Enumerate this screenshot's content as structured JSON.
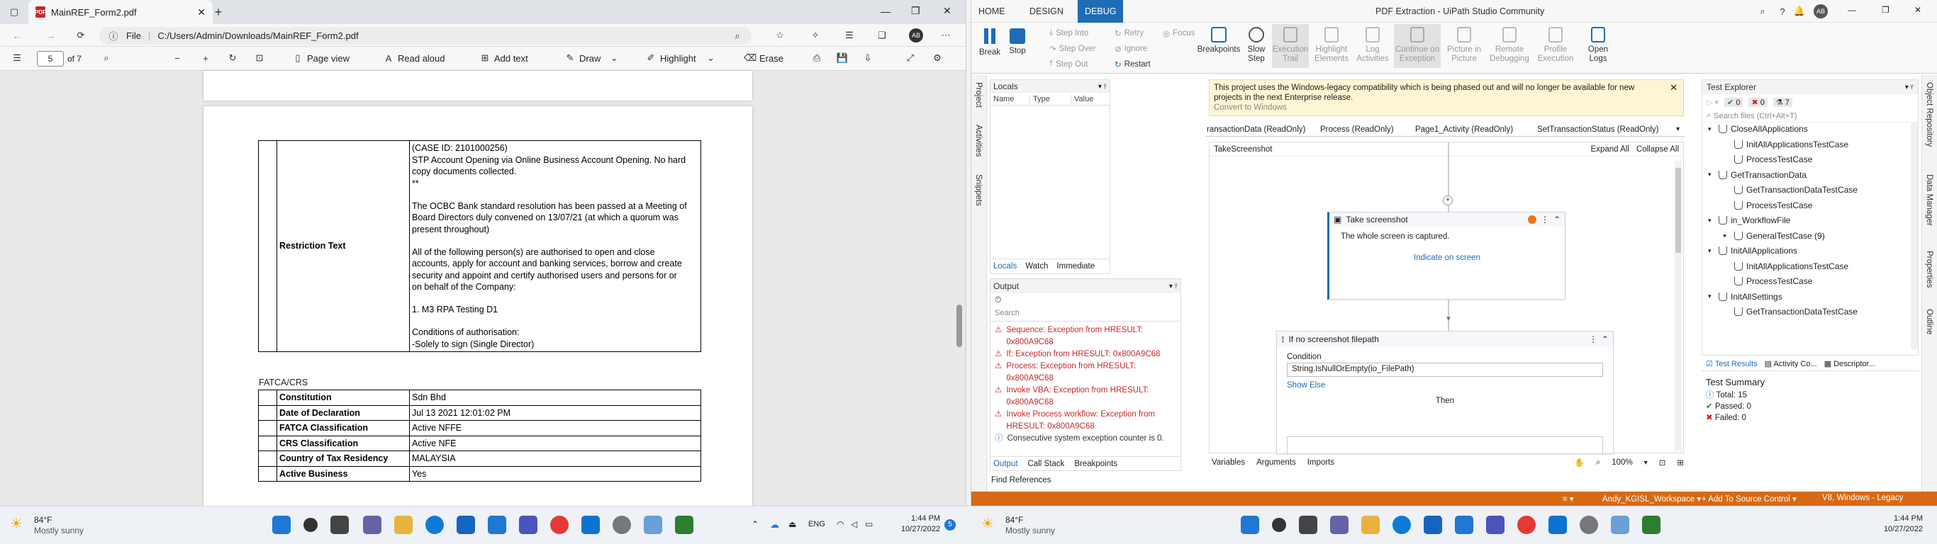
{
  "edge": {
    "tab_title": "MainREF_Form2.pdf",
    "address_label": "File",
    "address_url": "C:/Users/Admin/Downloads/MainREF_Form2.pdf",
    "profile": "AB",
    "page_current": "5",
    "page_total": "of 7",
    "toolbar": {
      "page_view": "Page view",
      "read_aloud": "Read aloud",
      "add_text": "Add text",
      "draw": "Draw",
      "highlight": "Highlight",
      "erase": "Erase"
    }
  },
  "document": {
    "restriction_label": "Restriction Text",
    "restriction_lines": [
      "(CASE ID: 2101000256)",
      "STP Account Opening via Online Business Account Opening. No hard",
      "copy documents collected.",
      "**",
      "",
      "The OCBC Bank standard resolution has been passed at a Meeting of",
      "Board Directors duly convened on 13/07/21 (at which a quorum was",
      "present throughout)",
      "",
      "All of the following person(s) are authorised to open and close",
      "accounts, apply for account and banking services, borrow and create",
      "security and appoint and certify authorised users and persons for or",
      "on behalf of the Company:",
      "",
      "1. M3 RPA Testing D1",
      "",
      "Conditions of authorisation:",
      "-Solely to sign (Single Director)"
    ],
    "section_heading": "FATCA/CRS",
    "fatca_rows": [
      {
        "label": "Constitution",
        "value": "Sdn Bhd"
      },
      {
        "label": "Date of Declaration",
        "value": "Jul 13 2021 12:01:02 PM"
      },
      {
        "label": "FATCA Classification",
        "value": "Active NFFE"
      },
      {
        "label": "CRS Classification",
        "value": "Active NFE"
      },
      {
        "label": "Country of Tax Residency",
        "value": "MALAYSIA"
      },
      {
        "label": "Active Business",
        "value": "Yes"
      }
    ]
  },
  "taskbar_left": {
    "temp": "84°F",
    "weather": "Mostly sunny",
    "lang": "ENG",
    "time": "1:44 PM",
    "date": "10/27/2022",
    "notif": "5"
  },
  "taskbar_right": {
    "temp": "84°F",
    "weather": "Mostly sunny",
    "time": "1:44 PM",
    "date": "10/27/2022"
  },
  "uipath": {
    "tabs": [
      "HOME",
      "DESIGN",
      "DEBUG"
    ],
    "active_tab": "DEBUG",
    "window_title": "PDF Extraction - UiPath Studio Community",
    "profile": "AB",
    "ribbon": {
      "break": "Break",
      "stop": "Stop",
      "step_into": "Step Into",
      "step_over": "Step Over",
      "step_out": "Step Out",
      "retry": "Retry",
      "ignore": "Ignore",
      "restart": "Restart",
      "focus": "Focus",
      "breakpoints": "Breakpoints",
      "slow_step": "Slow Step",
      "execution_trail": "Execution Trail",
      "highlight_elements": "Highlight Elements",
      "log_activities": "Log Activities",
      "continue_on_exception": "Continue on Exception",
      "picture_in_picture": "Picture in Picture",
      "remote_debugging": "Remote Debugging",
      "profile_execution": "Profile Execution",
      "open_logs": "Open Logs"
    },
    "side_tabs": [
      "Project",
      "Activities",
      "Snippets"
    ],
    "locals": {
      "title": "Locals",
      "columns": [
        "Name",
        "Type",
        "Value"
      ],
      "bottom_tabs": [
        "Locals",
        "Watch",
        "Immediate"
      ]
    },
    "output": {
      "title": "Output",
      "search_placeholder": "Search",
      "lines": [
        {
          "text": "Sequence: Exception from HRESULT: 0x800A9C68",
          "kind": "error"
        },
        {
          "text": "If: Exception from HRESULT: 0x800A9C68",
          "kind": "error"
        },
        {
          "text": "Process: Exception from HRESULT: 0x800A9C68",
          "kind": "error"
        },
        {
          "text": "Invoke VBA: Exception from HRESULT: 0x800A9C68",
          "kind": "error"
        },
        {
          "text": "Invoke Process workflow: Exception from HRESULT: 0x800A9C68",
          "kind": "error"
        },
        {
          "text": "Consecutive system exception counter is 0.",
          "kind": "info"
        }
      ],
      "bottom_tabs": [
        "Output",
        "Call Stack",
        "Breakpoints"
      ]
    },
    "banner": {
      "text": "This project uses the Windows-legacy compatibility which is being phased out and will no longer be available for new projects in the next Enterprise release.",
      "link": "Convert to Windows"
    },
    "doc_tabs": [
      "ransactionData (ReadOnly)",
      "Process (ReadOnly)",
      "Page1_Activity (ReadOnly)",
      "SetTransactionStatus (ReadOnly)"
    ],
    "breadcrumb": "TakeScreenshot",
    "expand_all": "Expand All",
    "collapse_all": "Collapse All",
    "activity1": {
      "title": "Take screenshot",
      "desc": "The whole screen is captured.",
      "link": "Indicate on screen"
    },
    "activity2": {
      "title": "If no screenshot filepath",
      "condition_label": "Condition",
      "condition": "String.IsNullOrEmpty(io_FilePath)",
      "show_else": "Show Else",
      "then": "Then"
    },
    "designer_bottom": [
      "Variables",
      "Arguments",
      "Imports"
    ],
    "zoom": "100%",
    "find_references": "Find References",
    "test_explorer": {
      "title": "Test Explorer",
      "counts": [
        "0",
        "0",
        "7"
      ],
      "search_placeholder": "Search files (Ctrl+Alt+T)",
      "tree": [
        {
          "label": "CloseAllApplications",
          "level": 0
        },
        {
          "label": "InitAllApplicationsTestCase",
          "level": 1
        },
        {
          "label": "ProcessTestCase",
          "level": 1
        },
        {
          "label": "GetTransactionData",
          "level": 0
        },
        {
          "label": "GetTransactionDataTestCase",
          "level": 1
        },
        {
          "label": "ProcessTestCase",
          "level": 1
        },
        {
          "label": "in_WorkflowFile",
          "level": 0
        },
        {
          "label": "GeneralTestCase (9)",
          "level": 1
        },
        {
          "label": "InitAllApplications",
          "level": 0
        },
        {
          "label": "InitAllApplicationsTestCase",
          "level": 1
        },
        {
          "label": "ProcessTestCase",
          "level": 1
        },
        {
          "label": "InitAllSettings",
          "level": 0
        },
        {
          "label": "GetTransactionDataTestCase",
          "level": 1
        }
      ],
      "bottom_tabs": [
        "Test Results",
        "Activity Co...",
        "Descriptor..."
      ],
      "summary_title": "Test Summary",
      "total": "Total: 15",
      "passed": "Passed: 0",
      "failed": "Failed: 0"
    },
    "right_side_tabs": [
      "Object Repository",
      "Data Manager",
      "Properties",
      "Outline"
    ],
    "status": {
      "workspace": "Andy_KGISL_Workspace",
      "source_control": "Add To Source Control",
      "version": "V8, Windows - Legacy"
    }
  },
  "colors": {
    "uipath_accent": "#1e6cb8",
    "status_bar": "#d66a15",
    "error_text": "#c62828"
  }
}
